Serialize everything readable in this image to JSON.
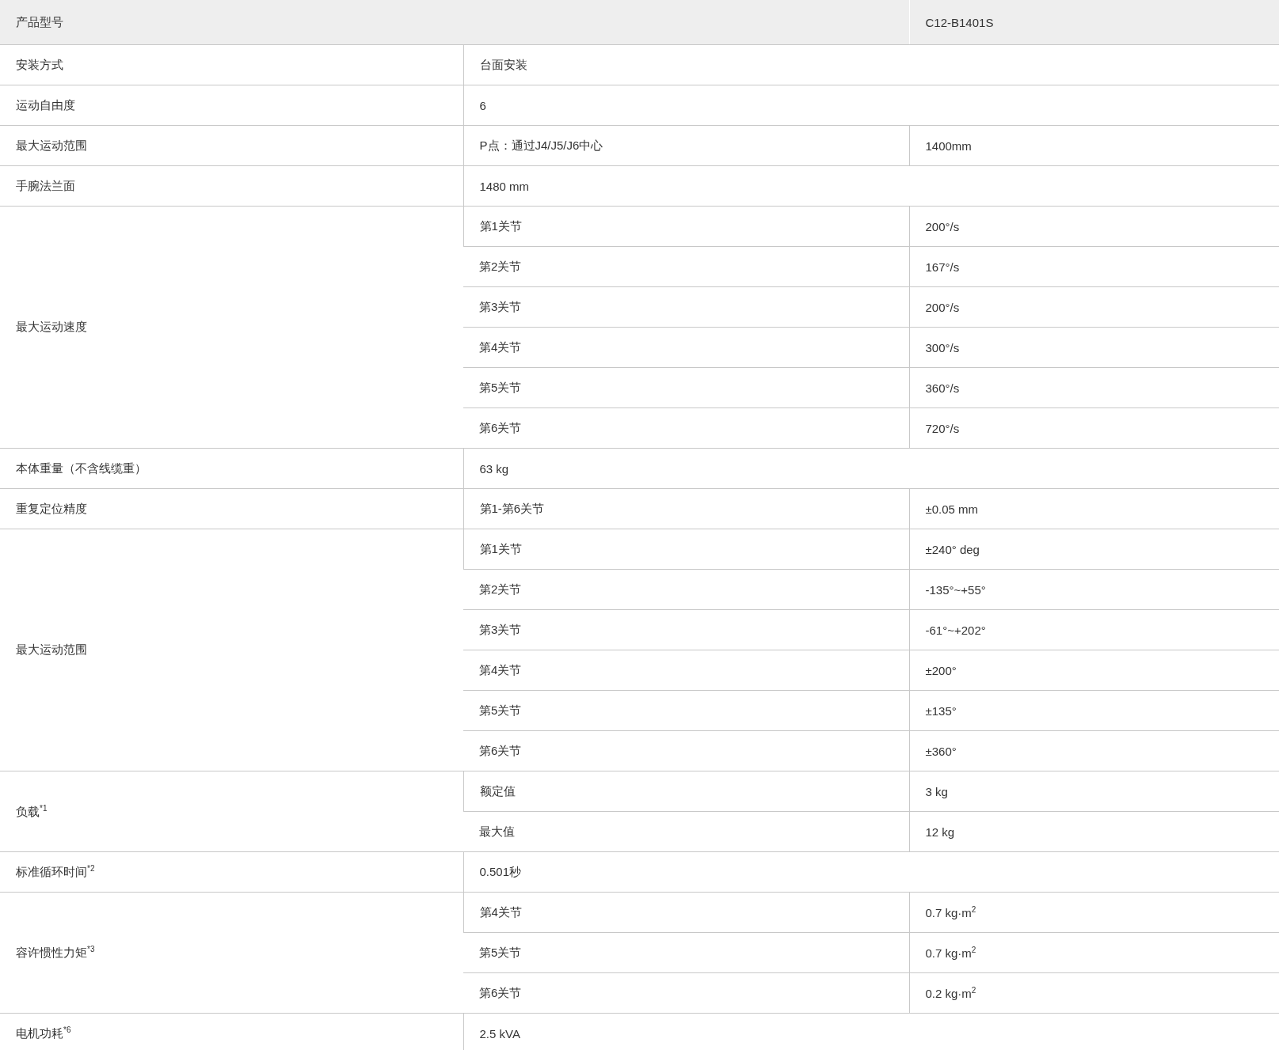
{
  "table": {
    "header": {
      "label": "产品型号",
      "value": "C12-B1401S"
    },
    "rows": [
      {
        "kind": "single",
        "label": "安装方式",
        "value": "台面安装"
      },
      {
        "kind": "single",
        "label": "运动自由度",
        "value": "6"
      },
      {
        "kind": "group",
        "label": "最大运动范围",
        "items": [
          {
            "name": "P点：通过J4/J5/J6中心",
            "value": "1400mm"
          }
        ]
      },
      {
        "kind": "single",
        "label": "手腕法兰面",
        "value": "1480 mm"
      },
      {
        "kind": "group",
        "label": "最大运动速度",
        "items": [
          {
            "name": "第1关节",
            "value": "200°/s"
          },
          {
            "name": "第2关节",
            "value": "167°/s"
          },
          {
            "name": "第3关节",
            "value": "200°/s"
          },
          {
            "name": "第4关节",
            "value": "300°/s"
          },
          {
            "name": "第5关节",
            "value": "360°/s"
          },
          {
            "name": "第6关节",
            "value": "720°/s"
          }
        ]
      },
      {
        "kind": "single",
        "label": "本体重量（不含线缆重）",
        "value": "63 kg"
      },
      {
        "kind": "group",
        "label": "重复定位精度",
        "items": [
          {
            "name": "第1-第6关节",
            "value": "±0.05 mm"
          }
        ]
      },
      {
        "kind": "group",
        "label": "最大运动范围",
        "items": [
          {
            "name": "第1关节",
            "value": "±240° deg"
          },
          {
            "name": "第2关节",
            "value": "-135°~+55°"
          },
          {
            "name": "第3关节",
            "value": "-61°~+202°"
          },
          {
            "name": "第4关节",
            "value": "±200°"
          },
          {
            "name": "第5关节",
            "value": "±135°"
          },
          {
            "name": "第6关节",
            "value": "±360°"
          }
        ]
      },
      {
        "kind": "group",
        "label": "负载$^{*1}$",
        "items": [
          {
            "name": "额定值",
            "value": "3 kg"
          },
          {
            "name": "最大值",
            "value": "12 kg"
          }
        ]
      },
      {
        "kind": "single",
        "label": "标准循环时间$^{*2}$",
        "value": "0.501秒"
      },
      {
        "kind": "group",
        "label": "容许惯性力矩$^{*3}$",
        "items": [
          {
            "name": "第4关节",
            "value": "0.7 kg·m$^{2}$"
          },
          {
            "name": "第5关节",
            "value": "0.7 kg·m$^{2}$"
          },
          {
            "name": "第6关节",
            "value": "0.2 kg·m$^{2}$"
          }
        ]
      },
      {
        "kind": "single",
        "label": "电机功耗$^{*6}$",
        "value": "2.5 kVA"
      }
    ]
  }
}
